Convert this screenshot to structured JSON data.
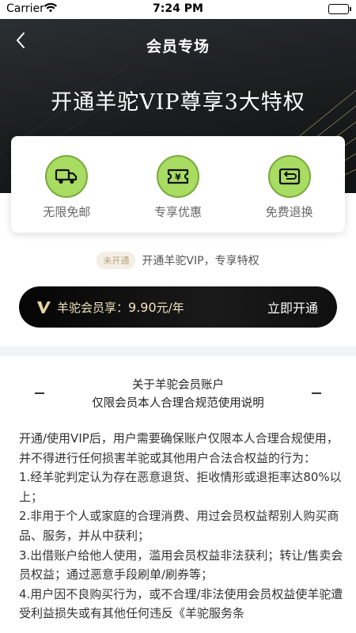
{
  "status_bar": {
    "carrier": "Carrier",
    "time": "7:24 PM"
  },
  "header": {
    "back_icon": "chevron-left-icon",
    "title": "会员专场"
  },
  "hero": {
    "heading": "开通羊驼VIP尊享3大特权"
  },
  "benefits": [
    {
      "icon": "truck-icon",
      "label": "无限免邮"
    },
    {
      "icon": "coupon-icon",
      "label": "专享优惠"
    },
    {
      "icon": "return-icon",
      "label": "免费退换"
    }
  ],
  "membership_status": {
    "tag": "未开通",
    "text": "开通羊驼VIP，专享特权"
  },
  "vip_bar": {
    "prefix": "羊驼会员享：",
    "price": "9.90",
    "unit": "元/年",
    "cta": "立即开通"
  },
  "notice": {
    "title_line1": "关于羊驼会员账户",
    "title_line2": "仅限会员本人合理合规范使用说明",
    "paragraphs": [
      "开通/使用VIP后，用户需要确保账户仅限本人合理合规使用，并不得进行任何损害羊驼或其他用户合法合权益的行为：",
      "1.经羊驼判定认为存在恶意退货、拒收情形或退拒率达80%以上；",
      "2.非用于个人或家庭的合理消费、用过会员权益帮别人购买商品、服务，并从中获利；",
      "3.出借账户给他人使用，滥用会员权益非法获利；转让/售卖会员权益；通过恶意手段刷单/刷券等；",
      "4.用户因不良购买行为，或不合理/非法使用会员权益使羊驼遭受利益损失或有其他任何违反《羊驼服务条"
    ]
  },
  "colors": {
    "accent_green": "#a8dc62",
    "gold": "#f2e3c0",
    "hero_dark": "#1a1c1e"
  }
}
